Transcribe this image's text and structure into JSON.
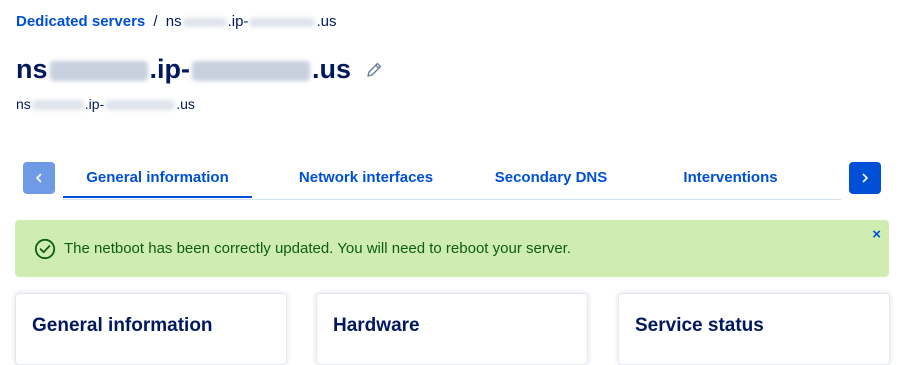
{
  "breadcrumb": {
    "parent": "Dedicated servers",
    "separator": "/",
    "current_prefix": "ns",
    "current_middle": ".ip-",
    "current_suffix": ".us"
  },
  "server": {
    "title_prefix": "ns",
    "title_middle": ".ip-",
    "title_suffix": ".us",
    "subtitle_prefix": "ns",
    "subtitle_middle": ".ip-",
    "subtitle_suffix": ".us",
    "edit_icon": "pencil-icon"
  },
  "tabs": {
    "prev_icon": "chevron-left-icon",
    "next_icon": "chevron-right-icon",
    "items": [
      {
        "label": "General information",
        "active": true
      },
      {
        "label": "Network interfaces",
        "active": false
      },
      {
        "label": "Secondary DNS",
        "active": false
      },
      {
        "label": "Interventions",
        "active": false
      }
    ]
  },
  "alert": {
    "icon": "check-circle-icon",
    "message": "The netboot has been correctly updated. You will need to reboot your server.",
    "close_label": "×",
    "background": "#cfedb0",
    "text_color": "#0d5c17"
  },
  "cards": [
    {
      "title": "General information"
    },
    {
      "title": "Hardware"
    },
    {
      "title": "Service status"
    }
  ],
  "colors": {
    "primary": "#0050d7",
    "text_dark": "#00185e",
    "disabled_arrow": "#6e9ae8"
  }
}
